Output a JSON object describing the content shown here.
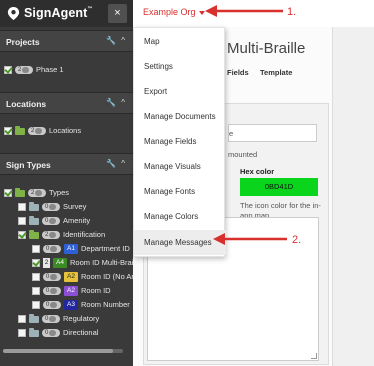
{
  "sidebar": {
    "brand": "SignAgent",
    "brand_mark": "™",
    "close": "×",
    "sections": {
      "projects": "Projects",
      "locations": "Locations",
      "sign_types": "Sign Types"
    },
    "tools": {
      "wrench": "🔧",
      "collapse": "^"
    },
    "projects": [
      {
        "label": "Phase 1",
        "badge": "2"
      }
    ],
    "locations": [
      {
        "label": "Locations",
        "badge": "2"
      }
    ],
    "sign_types": [
      {
        "label": "Types",
        "badge": "2"
      },
      {
        "label": "Survey",
        "badge": "0"
      },
      {
        "label": "Amenity",
        "badge": "0"
      },
      {
        "label": "Identification",
        "badge": "2"
      },
      {
        "label": "Department ID",
        "badge": "0",
        "code": "A1",
        "color": "#2d5fd5"
      },
      {
        "label": "Room ID Multi-Braille",
        "badge": "2",
        "code": "A4",
        "color": "#3a8b24"
      },
      {
        "label": "Room ID (No Art)",
        "badge": "0",
        "code": "A2",
        "color": "#e6c13a"
      },
      {
        "label": "Room ID",
        "badge": "0",
        "code": "A2",
        "color": "#8a4fd3"
      },
      {
        "label": "Room Number",
        "badge": "0",
        "code": "A3",
        "color": "#23279e"
      },
      {
        "label": "Regulatory",
        "badge": "0"
      },
      {
        "label": "Directional",
        "badge": "0"
      }
    ]
  },
  "topbar": {
    "org": "Example Org"
  },
  "page": {
    "title": "Multi-Braille",
    "tabs": [
      "Fields",
      "Template"
    ],
    "input_value": "e",
    "mounted": "mounted",
    "hex_label": "Hex color",
    "hex_value": "0BD41D",
    "hex_help": "The icon color for the in-app map.",
    "accent": "#0bd41d"
  },
  "dropdown": {
    "items": [
      "Map",
      "Settings",
      "Export",
      "Manage Documents",
      "Manage Fields",
      "Manage Visuals",
      "Manage Fonts",
      "Manage Colors",
      "Manage Messages"
    ],
    "highlighted": "Manage Messages"
  },
  "annotations": {
    "step1": "1.",
    "step2": "2.",
    "color": "#d7302d"
  }
}
